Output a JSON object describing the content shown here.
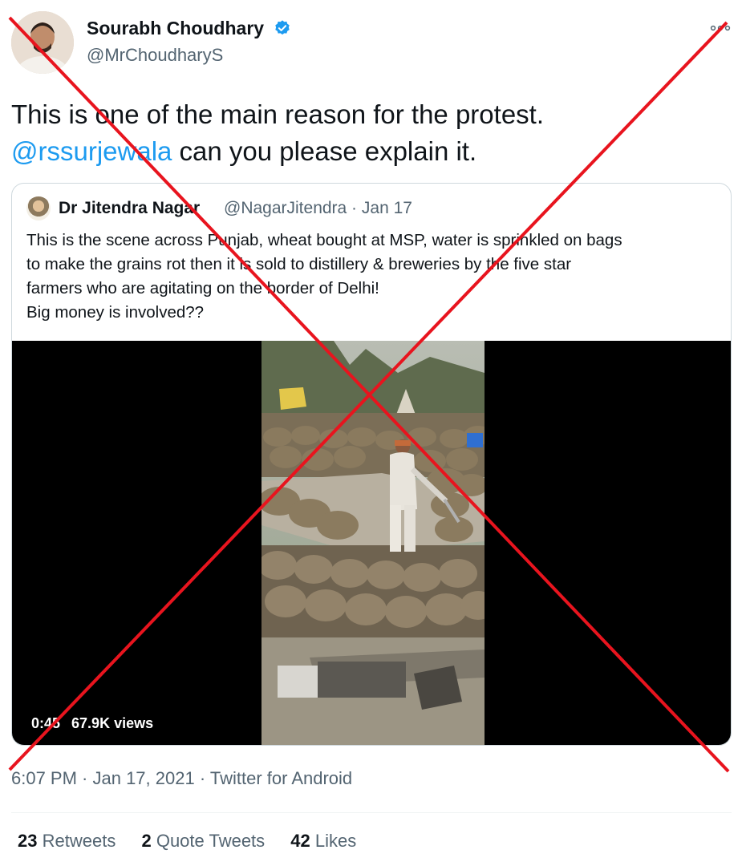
{
  "author": {
    "name": "Sourabh Choudhary",
    "handle": "@MrChoudharyS"
  },
  "tweet": {
    "text_line1": "This is one of the main reason for the protest.",
    "mention": "@rssurjewala",
    "text_line2_rest": " can you please explain it."
  },
  "quote": {
    "name": "Dr Jitendra Nagar",
    "handle_date": "@NagarJitendra · Jan 17",
    "lines": [
      "This is the scene across Punjab, wheat bought at MSP, water is sprinkled on bags",
      "to make the grains rot then it is sold to distillery & breweries by the five star",
      "farmers who are agitating on the border of Delhi!",
      "Big money is involved??"
    ],
    "video": {
      "duration": "0:45",
      "views": "67.9K views"
    }
  },
  "meta": "6:07 PM · Jan 17, 2021 · Twitter for Android",
  "stats": {
    "retweets_count": "23",
    "retweets_label": "Retweets",
    "quotes_count": "2",
    "quotes_label": "Quote Tweets",
    "likes_count": "42",
    "likes_label": "Likes"
  },
  "colors": {
    "link": "#1d9bf0",
    "cross": "#e8141e"
  }
}
